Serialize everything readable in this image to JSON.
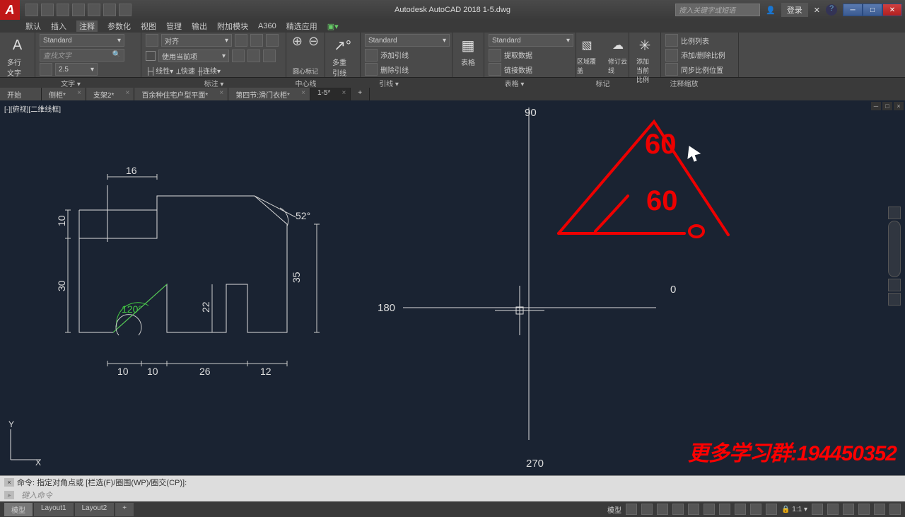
{
  "app": {
    "title": "Autodesk AutoCAD 2018   1-5.dwg",
    "logo": "A"
  },
  "search": {
    "placeholder": "搜入关键字或短语"
  },
  "login": "登录",
  "menu": [
    "默认",
    "插入",
    "注释",
    "参数化",
    "视图",
    "管理",
    "输出",
    "附加模块",
    "A360",
    "精选应用"
  ],
  "ribbon": {
    "text_panel": {
      "big_label": "多行文字",
      "icon": "A",
      "style_dd": "Standard",
      "find_dd": "查找文字",
      "size_dd": "2.5",
      "panel": "文字"
    },
    "dim_panel": {
      "style_dd": "对齐",
      "use_current": "使用当前项",
      "linear": "线性",
      "quick": "快速",
      "continue": "连续",
      "panel": "标注"
    },
    "center_panel": {
      "mark": "圆心标记",
      "line": "中心线",
      "panel": "中心线"
    },
    "leader_panel": {
      "big": "多重引线",
      "style": "Standard",
      "add": "添加引线",
      "remove": "删除引线",
      "panel": "引线"
    },
    "table_panel": {
      "big": "表格",
      "style": "Standard",
      "extract": "提取数据",
      "link": "链接数据",
      "panel": "表格"
    },
    "markup_panel": {
      "cover": "区域覆盖",
      "revise": "修订云线",
      "panel": "标记"
    },
    "scale_panel": {
      "add": "添加当前比例",
      "list": "比例列表",
      "addrm": "添加/删除比例",
      "sync": "同步比例位置",
      "panel": "注释缩放"
    }
  },
  "doctabs": [
    "开始",
    "侧柜*",
    "支架2*",
    "百余种住宅户型平面*",
    "第四节:滑门衣柜*",
    "1-5*"
  ],
  "viewport_label": "[-][俯视][二维线框]",
  "drawing": {
    "dims": {
      "d16": "16",
      "d10a": "10",
      "d30": "30",
      "d120": "120°",
      "d52": "52°",
      "d35": "35",
      "d22": "22",
      "d10b": "10",
      "d10c": "10",
      "d26": "26",
      "d12": "12"
    },
    "compass": {
      "n": "90",
      "s": "270",
      "e": "0",
      "w": "180"
    },
    "red": {
      "top": "60",
      "mid": "60"
    },
    "ucs": {
      "x": "X",
      "y": "Y"
    }
  },
  "watermark": "更多学习群:194450352",
  "cmd": {
    "hist": "命令: 指定对角点或 [栏选(F)/圈围(WP)/圈交(CP)]:",
    "prompt": "键入命令"
  },
  "status": {
    "tabs": [
      "模型",
      "Layout1",
      "Layout2"
    ],
    "model": "模型",
    "scale": "1:1"
  }
}
